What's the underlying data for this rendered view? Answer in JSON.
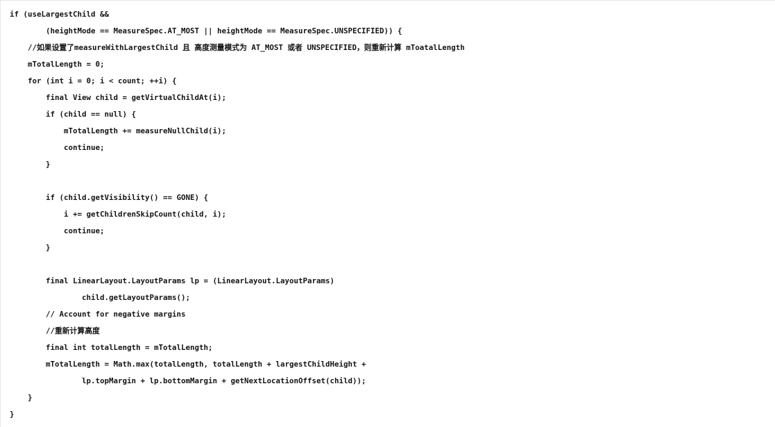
{
  "viewer": {
    "kind": "code-snippet",
    "language": "Java",
    "background_color": "#ffffff",
    "text_color": "#141414",
    "border_color": "#e6e6e6",
    "font_size_px": 10.8,
    "line_height_px": 24,
    "indent_unit_spaces": 4
  },
  "code": {
    "lines": [
      "if (useLargestChild &&",
      "        (heightMode == MeasureSpec.AT_MOST || heightMode == MeasureSpec.UNSPECIFIED)) {",
      "    //如果设置了measureWithLargestChild 且 高度测量模式为 AT_MOST 或者 UNSPECIFIED，则重新计算 mToatalLength",
      "    mTotalLength = 0;",
      "    for (int i = 0; i < count; ++i) {",
      "        final View child = getVirtualChildAt(i);",
      "        if (child == null) {",
      "            mTotalLength += measureNullChild(i);",
      "            continue;",
      "        }",
      "",
      "        if (child.getVisibility() == GONE) {",
      "            i += getChildrenSkipCount(child, i);",
      "            continue;",
      "        }",
      "",
      "        final LinearLayout.LayoutParams lp = (LinearLayout.LayoutParams)",
      "                child.getLayoutParams();",
      "        // Account for negative margins",
      "        //重新计算高度",
      "        final int totalLength = mTotalLength;",
      "        mTotalLength = Math.max(totalLength, totalLength + largestChildHeight +",
      "                lp.topMargin + lp.bottomMargin + getNextLocationOffset(child));",
      "    }",
      "}"
    ]
  }
}
